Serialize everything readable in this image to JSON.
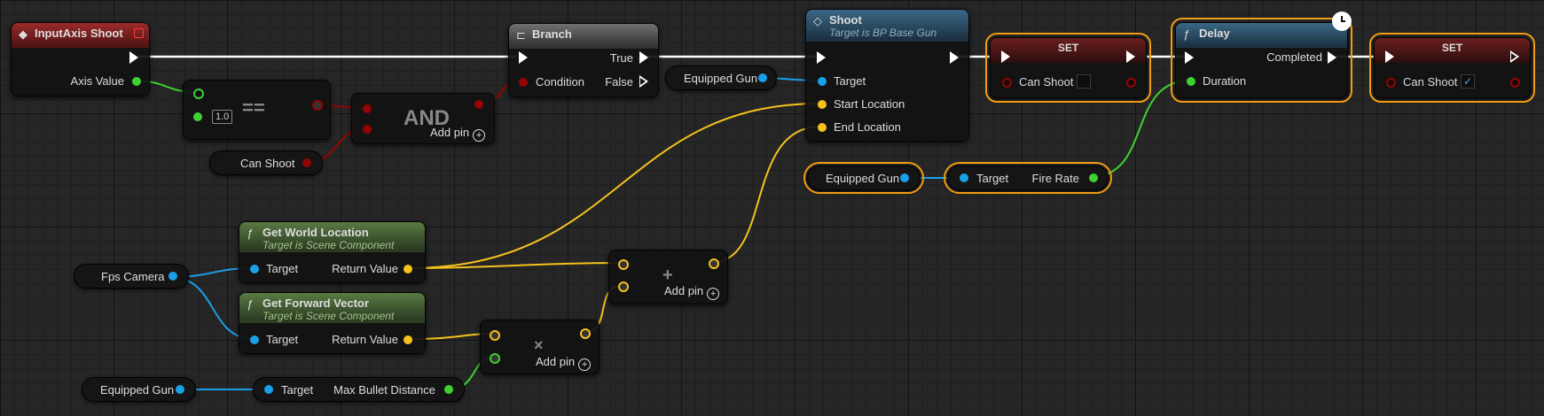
{
  "colors": {
    "exec": "#ffffff",
    "bool": "#940404",
    "object": "#1aa0e8",
    "vector": "#f5c21d",
    "float": "#3ed131",
    "selection": "#f39c12"
  },
  "nodes": {
    "input_axis": {
      "title": "InputAxis Shoot",
      "pin_axis_value": "Axis Value"
    },
    "equals": {
      "op": "==",
      "literal": "1.0"
    },
    "and": {
      "op": "AND",
      "add_pin": "Add pin"
    },
    "can_shoot_var": {
      "label": "Can Shoot"
    },
    "branch": {
      "title": "Branch",
      "pin_condition": "Condition",
      "pin_true": "True",
      "pin_false": "False"
    },
    "equipped_gun_1": {
      "label": "Equipped Gun"
    },
    "shoot": {
      "title": "Shoot",
      "subtitle": "Target is BP Base Gun",
      "pin_target": "Target",
      "pin_start": "Start Location",
      "pin_end": "End Location"
    },
    "set1": {
      "title": "SET",
      "pin": "Can Shoot",
      "checked": false
    },
    "delay": {
      "title": "Delay",
      "pin_completed": "Completed",
      "pin_duration": "Duration"
    },
    "set2": {
      "title": "SET",
      "pin": "Can Shoot",
      "checked": true
    },
    "equipped_gun_2": {
      "label": "Equipped Gun"
    },
    "fire_rate": {
      "pin_target": "Target",
      "pin_out": "Fire Rate"
    },
    "get_world_location": {
      "title": "Get World Location",
      "subtitle": "Target is Scene Component",
      "pin_target": "Target",
      "pin_out": "Return Value"
    },
    "get_forward_vector": {
      "title": "Get Forward Vector",
      "subtitle": "Target is Scene Component",
      "pin_target": "Target",
      "pin_out": "Return Value"
    },
    "fps_camera": {
      "label": "Fps Camera"
    },
    "add_node": {
      "op": "+",
      "add_pin": "Add pin"
    },
    "multiply_node": {
      "op": "×",
      "add_pin": "Add pin"
    },
    "equipped_gun_3": {
      "label": "Equipped Gun"
    },
    "max_bullet": {
      "pin_target": "Target",
      "pin_out": "Max Bullet Distance"
    }
  }
}
